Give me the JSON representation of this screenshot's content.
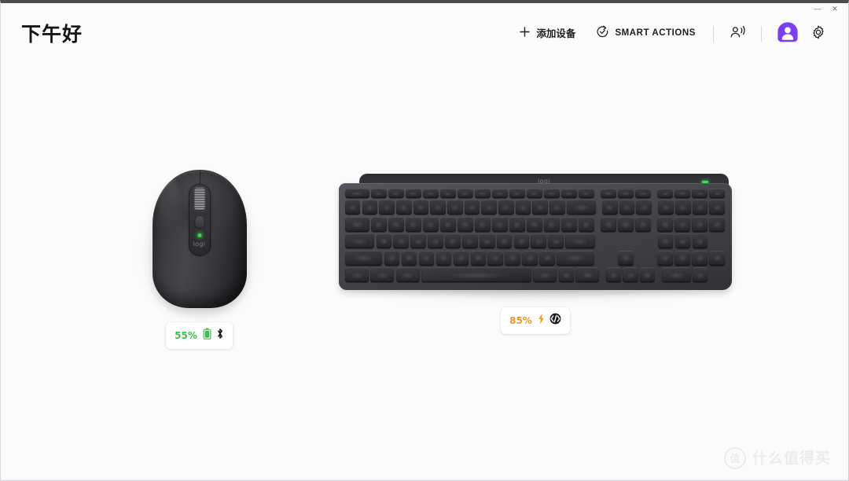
{
  "window": {
    "controls": [
      {
        "name": "minimize",
        "glyph": "—"
      },
      {
        "name": "close",
        "glyph": "✕"
      }
    ]
  },
  "header": {
    "greeting": "下午好",
    "toolbar": {
      "add_device": {
        "label": "添加设备",
        "icon": "plus-icon"
      },
      "smart_actions": {
        "label": "SMART ACTIONS",
        "icon": "check-circle-arrow-icon"
      },
      "voice": {
        "icon": "person-sound-icon"
      },
      "account": {
        "icon": "avatar-icon",
        "color": "#7b3ff0"
      },
      "settings": {
        "icon": "gear-icon"
      }
    }
  },
  "devices": [
    {
      "id": "mouse",
      "name": "logi-mx-anywhere-mouse",
      "brand_logo": "logi",
      "battery": {
        "percent": "55%",
        "color": "#3cbf4e",
        "battery_icon": "battery-icon",
        "connection_icon": "bluetooth-icon"
      }
    },
    {
      "id": "keyboard",
      "name": "logi-mx-keys-keyboard",
      "brand_logo": "logi",
      "battery": {
        "percent": "85%",
        "color": "#f0932b",
        "battery_icon": "charging-bolt-icon",
        "connection_icon": "logi-bolt-icon"
      }
    }
  ],
  "watermark": {
    "mark": "值",
    "text": "什么值得买"
  }
}
